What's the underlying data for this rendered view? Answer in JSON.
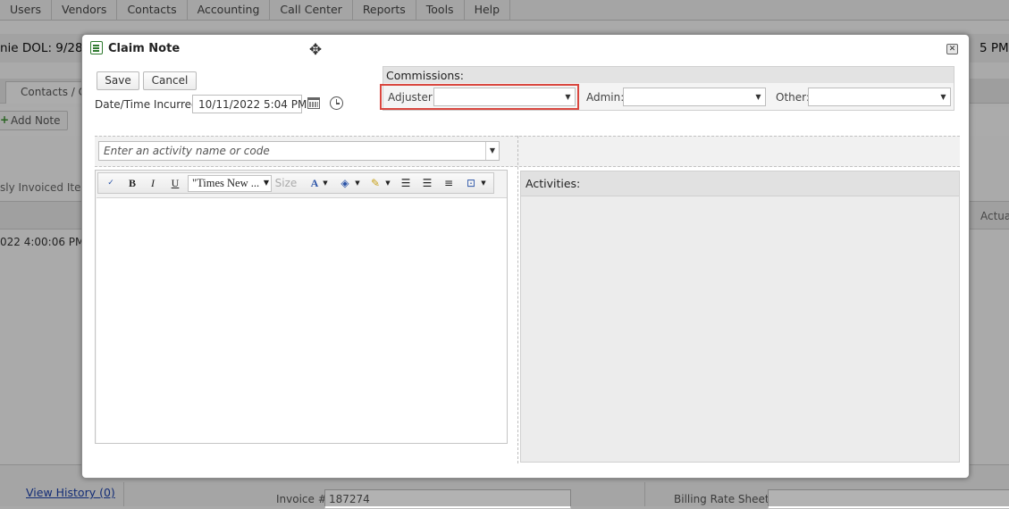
{
  "menu": [
    "Users",
    "Vendors",
    "Contacts",
    "Accounting",
    "Call Center",
    "Reports",
    "Tools",
    "Help"
  ],
  "background": {
    "claim_header": "nie   DOL: 9/28/",
    "header_time_fragment": "5 PM",
    "tab_label": "Contacts / Cl",
    "add_note_label": "Add Note",
    "invoiced_label": "sly Invoiced Item",
    "actual_col": "Actual",
    "row_date": "022 4:00:06 PM",
    "view_history": "View History (0)",
    "invoice_label": "Invoice #:",
    "invoice_value": "187274",
    "billing_label": "Billing Rate Sheet:"
  },
  "dialog": {
    "title": "Claim Note",
    "save_label": "Save",
    "cancel_label": "Cancel",
    "datetime_label": "Date/Time Incurred:",
    "datetime_value": "10/11/2022 5:04 PM",
    "commissions": {
      "title": "Commissions:",
      "adjuster_label": "Adjuster:",
      "adjuster_value": "",
      "admin_label": "Admin:",
      "admin_value": "",
      "other_label": "Other:",
      "other_value": ""
    },
    "activity_placeholder": "Enter an activity name or code",
    "editor": {
      "font_value": "\"Times New ...",
      "size_placeholder": "Size",
      "bold": "B",
      "italic": "I",
      "underline": "U",
      "font_color": "A"
    },
    "activities_title": "Activities:"
  },
  "colors": {
    "highlight": "#d9473f",
    "note_icon": "#2f7a2f",
    "link": "#1a3faa"
  }
}
